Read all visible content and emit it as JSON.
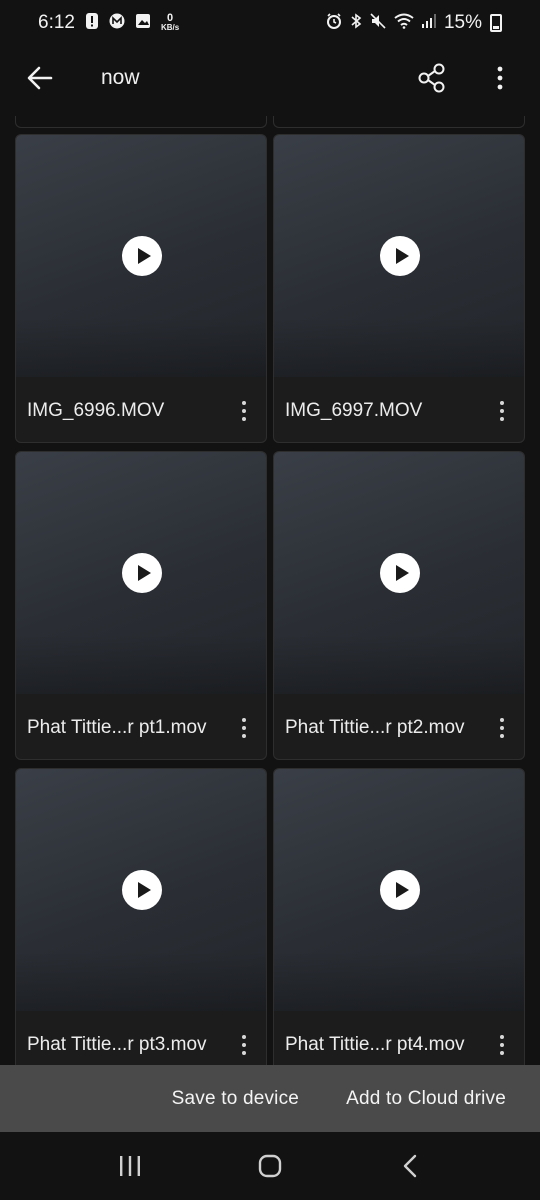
{
  "status_bar": {
    "time": "6:12",
    "net_speed_value": "0",
    "net_speed_unit": "KB/s",
    "battery": "15%"
  },
  "toolbar": {
    "title": "now",
    "back_icon": "arrow-left-icon",
    "share_icon": "share-icon",
    "more_icon": "more-vertical-icon"
  },
  "grid": {
    "items": [
      {
        "name": "IMG_6996.MOV",
        "type": "video"
      },
      {
        "name": "IMG_6997.MOV",
        "type": "video"
      },
      {
        "name": "Phat Tittie...r pt1.mov",
        "type": "video"
      },
      {
        "name": "Phat Tittie...r pt2.mov",
        "type": "video"
      },
      {
        "name": "Phat Tittie...r pt3.mov",
        "type": "video"
      },
      {
        "name": "Phat Tittie...r pt4.mov",
        "type": "video"
      }
    ]
  },
  "action_bar": {
    "save_label": "Save to device",
    "cloud_label": "Add to Cloud drive"
  },
  "nav_bar": {
    "recents_icon": "recent-apps-icon",
    "home_icon": "home-icon",
    "back_icon": "nav-back-icon"
  },
  "colors": {
    "background": "#121212",
    "card": "#1c1c1c",
    "action_bar": "#4a4a4a",
    "text": "#e8e8e8"
  }
}
